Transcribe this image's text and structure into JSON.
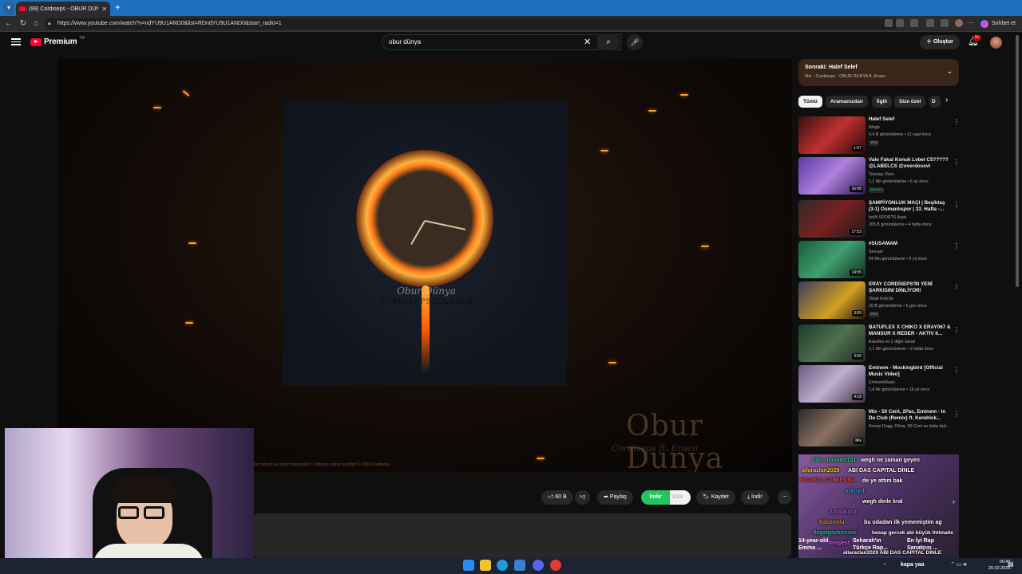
{
  "browser": {
    "tab_title": "(99) Cordiseps - OBUR DUNYA ft.",
    "url": "https://www.youtube.com/watch?v=ndYU9U1AND0&list=RDndYU9U1AND0&start_radio=1",
    "copilot_label": "Sohbet et"
  },
  "header": {
    "logo_text": "Premium",
    "logo_region": "TR",
    "search_value": "obur dünya",
    "create_label": "Oluştur",
    "notif_count": "9+"
  },
  "player": {
    "cover_script": "Obur Dünya",
    "cover_sub": "CORDISEPSXLLRAEN",
    "watermark_title": "Obur Dunya",
    "watermark_sub": "Cordiseps ft. Eraen",
    "copyright": "tüm görsel ve işitsel materyaller Cordiseps adına tescillidir © 2026 Cordiseps"
  },
  "actions": {
    "like_count": "60 B",
    "share_label": "Paylaş",
    "download_label": "İndir",
    "download_amount": "1000",
    "save_label": "Kaydet",
    "download2_label": "İndir"
  },
  "upnext": {
    "title": "Sonraki: Halef Selef",
    "subtitle": "Mix - Cordiseps - OBUR DUNYA ft. Eraen"
  },
  "chips": [
    "Tümü",
    "Aramanızdan",
    "İlgili",
    "Size özel",
    "D"
  ],
  "recommendations": [
    {
      "title": "Halef Selef",
      "channel": "Wegh",
      "views": "4,4 B görüntüleme • 11 saat önce",
      "badge": "Yeni",
      "duration": "1:57"
    },
    {
      "title": "Valo Fakat Konuk Lvbel C5????? @LABELCS @overdosevl",
      "channel": "Tolunay Ören",
      "views": "1,1 Mn görüntüleme • 6 ay önce",
      "badge": "Devam",
      "duration": "16:08"
    },
    {
      "title": "ŞAMPİYONLUK MAÇI | Beşiktaş (3-1) Osmanlıspor | 33. Hafta -...",
      "channel": "beIN SPORTS Arşiv",
      "views": "205 B görüntüleme • 4 hafta önce",
      "badge": "",
      "duration": "17:53"
    },
    {
      "title": "#SUSAMAM",
      "channel": "Şanışer",
      "views": "54 Mn görüntüleme • 6 yıl önce",
      "badge": "",
      "duration": "14:55"
    },
    {
      "title": "ERAY CORDİSEPS'İN YENİ ŞARKISINI DİNLİYOR!",
      "channel": "Odak Kick'de",
      "views": "25 B görüntüleme • 6 gün önce",
      "badge": "Yeni",
      "duration": "3:55"
    },
    {
      "title": "BATUFLEX X CHIKO X ERAY067 & MANSUR X REDER - AKTIV II...",
      "channel": "Batuflex ve 2 diğer kanal",
      "views": "1,1 Mn görüntüleme • 2 hafta önce",
      "badge": "",
      "duration": "3:06"
    },
    {
      "title": "Eminem - Mockingbird [Official Music Video]",
      "channel": "EminemMusic",
      "views": "1,4 Mr görüntüleme • 16 yıl önce",
      "badge": "",
      "duration": "4:18"
    },
    {
      "title": "Mix - 50 Cent, 2Pac, Eminem - In Da Club (Remix) ft. Kendrick...",
      "channel": "Snoop Dogg, Olivia, 50 Cent ve daha fazl...",
      "views": "",
      "badge": "",
      "duration": "Mix"
    }
  ],
  "chat": [
    {
      "text": "hiko_babadrl131",
      "color": "#2ecc71"
    },
    {
      "text": "wegh ne zaman geyen",
      "color": "#ffffff"
    },
    {
      "text": "allarazlan2029",
      "color": "#f1c40f"
    },
    {
      "text": "ABI DAS CAPITAL DİNLE",
      "color": "#ffffff"
    },
    {
      "text": "de ye attım bak",
      "color": "#ffffff"
    },
    {
      "text": "RICARDO_COMBESIMA",
      "color": "#e74c3c"
    },
    {
      "text": "ozknyrf",
      "color": "#3498db"
    },
    {
      "text": "wegh dinle kral",
      "color": "#ffffff"
    },
    {
      "text": "Ardaakgull",
      "color": "#9b59b6"
    },
    {
      "text": "trabzonlu",
      "color": "#e67e22"
    },
    {
      "text": "bu odadan ilk yememiştim ag",
      "color": "#ffffff"
    },
    {
      "text": "dogalgazborusu",
      "color": "#1abc9c"
    },
    {
      "text": "hesap gercek abi büyük ihtimalle",
      "color": "#ffffff"
    },
    {
      "text": "Tempest",
      "color": "#e056fd"
    },
    {
      "text": "allarazlan2029 ABI DAS CAPITAL DİNLE",
      "color": "#ffffff"
    }
  ],
  "shorts": [
    {
      "title": "14-year-old Emma ..."
    },
    {
      "title": "Seharah'ın Türkçe Rap..."
    },
    {
      "title": "En İyi Rap Sanatçısı ..."
    }
  ],
  "taskbar": {
    "tray_user": "kapa yaa",
    "time": "00:45",
    "date": "20.02.2026"
  }
}
